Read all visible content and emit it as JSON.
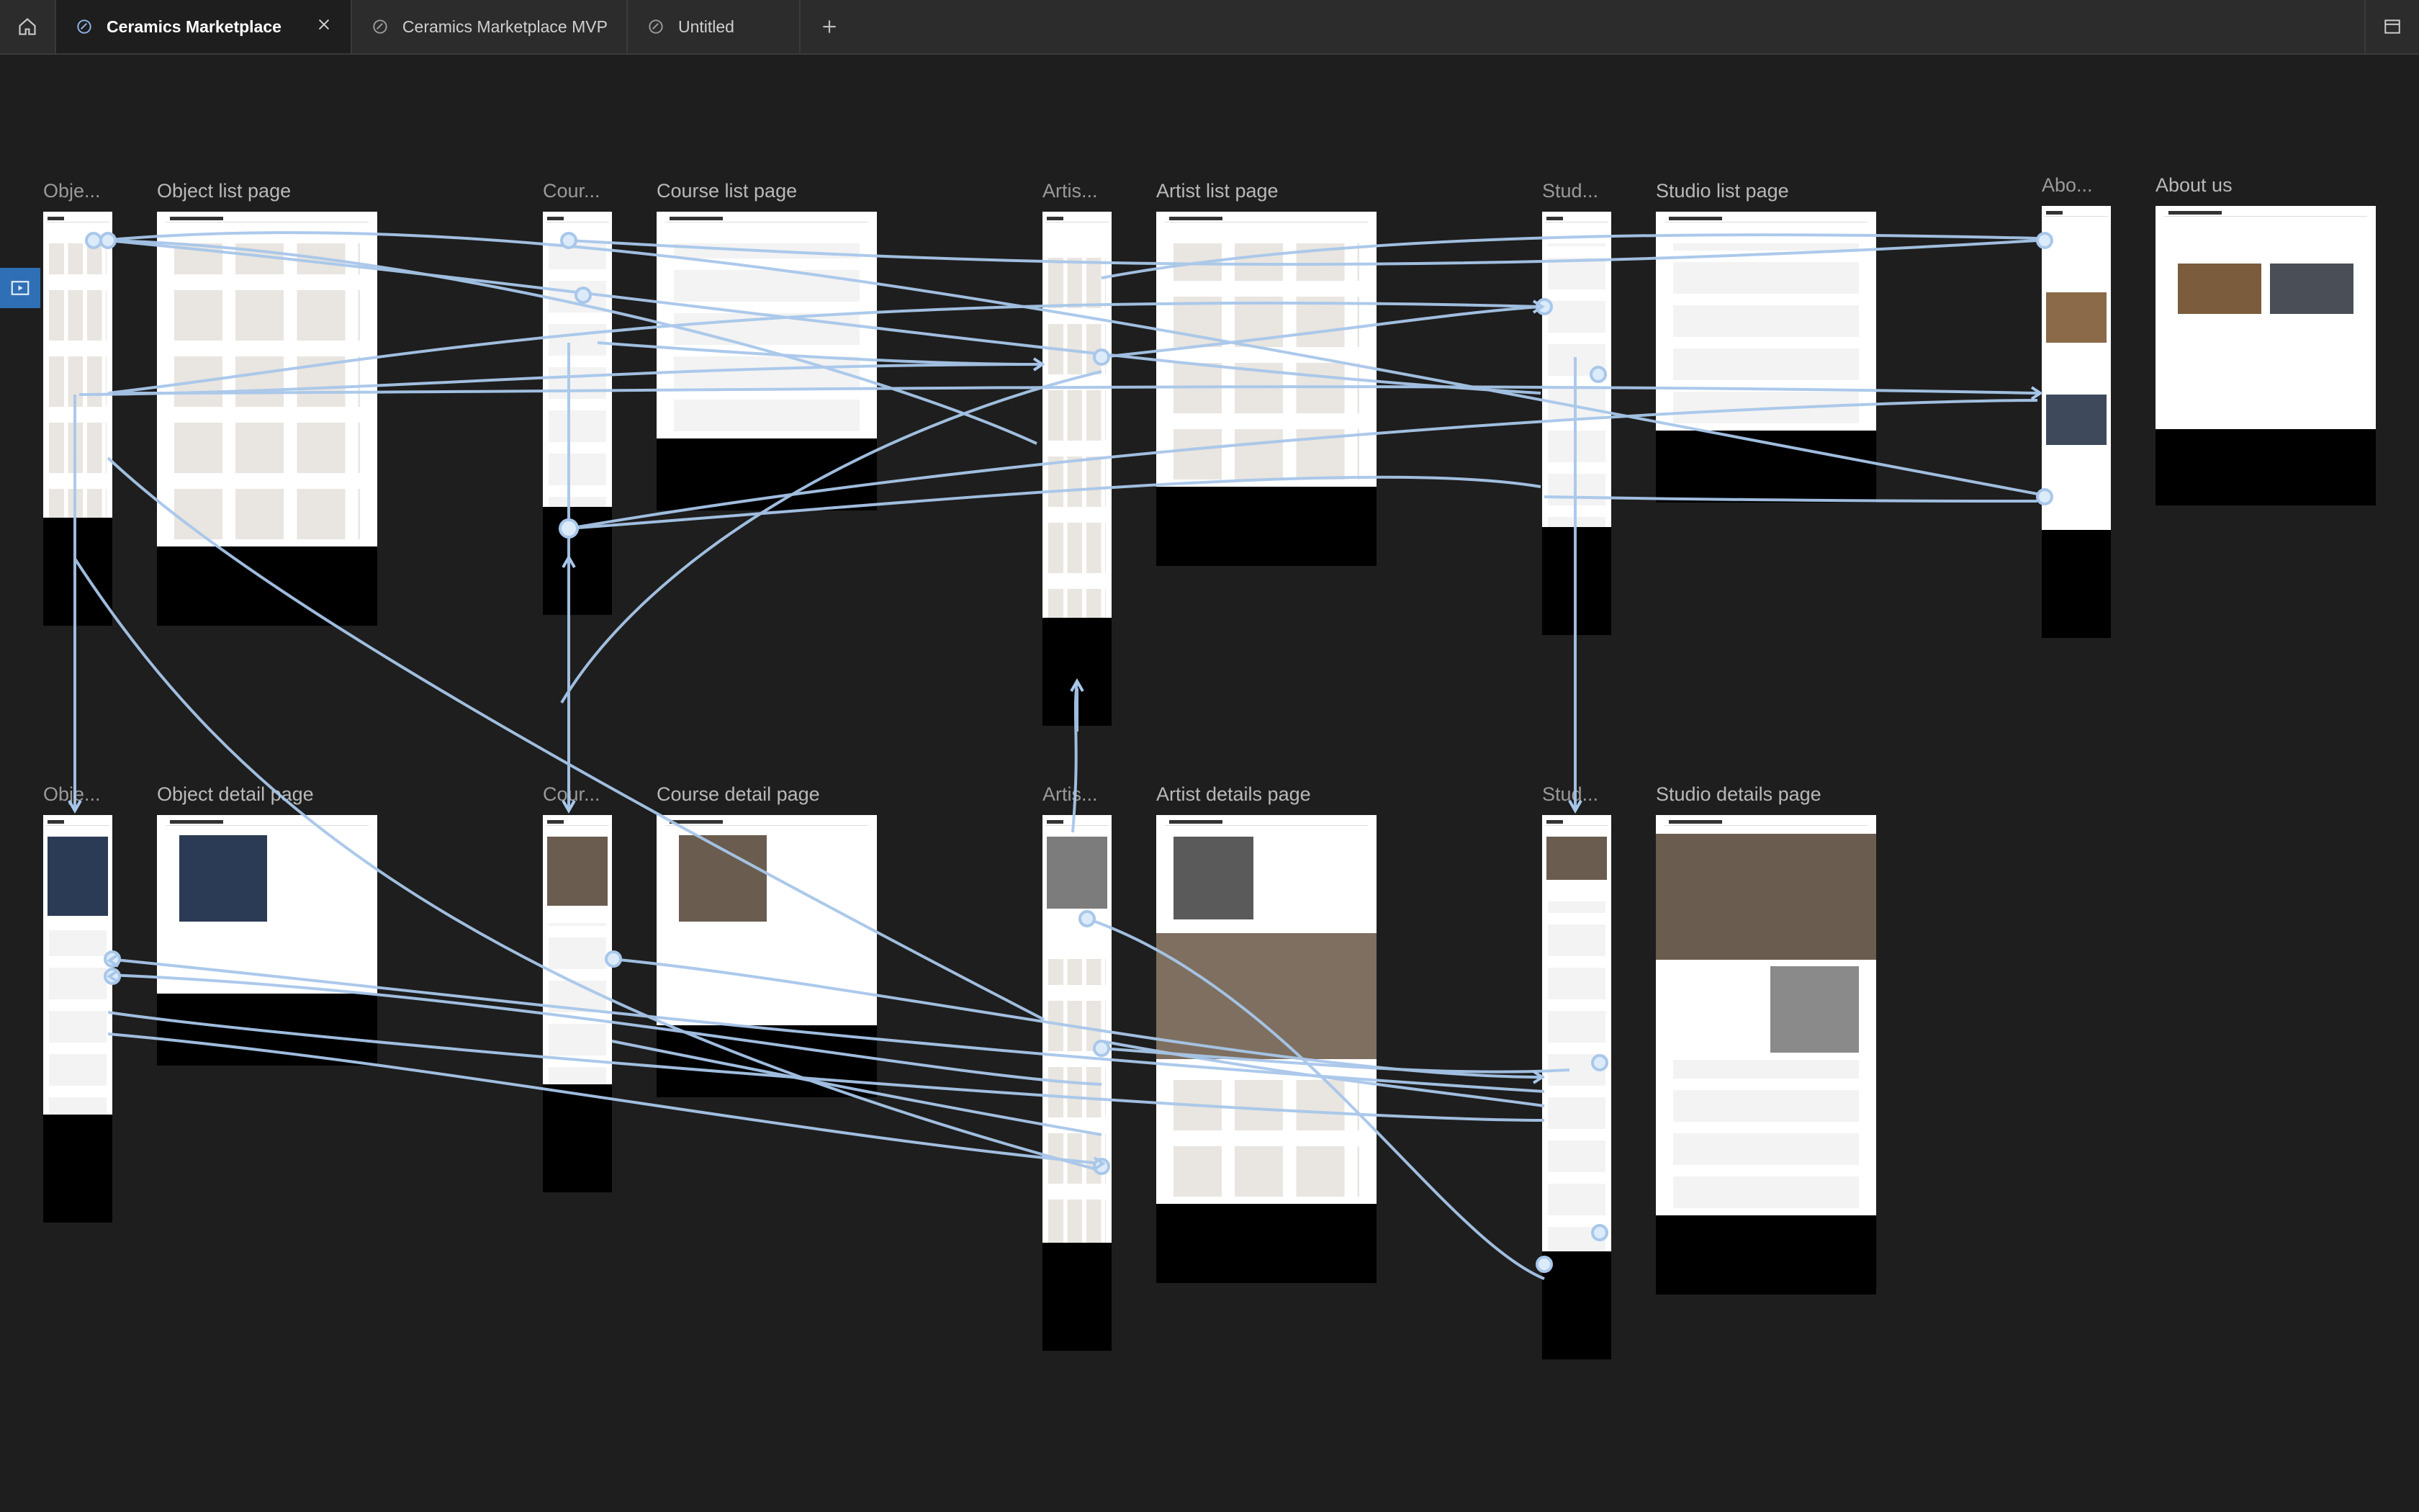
{
  "tabs": [
    {
      "label": "Ceramics Marketplace",
      "active": true
    },
    {
      "label": "Ceramics Marketplace MVP",
      "active": false
    },
    {
      "label": "Untitled",
      "active": false
    }
  ],
  "icons": {
    "home": "home-icon",
    "file": "file-icon",
    "close": "close-icon",
    "add": "plus-icon",
    "panel": "panel-icon",
    "flow": "flow-start-icon"
  },
  "colors": {
    "canvas": "#1e1e1e",
    "tabbar": "#2c2c2c",
    "connector": "#a8c7ea",
    "frame_label": "#9a9a9a"
  },
  "frames": {
    "object_list_mobile": "Obje...",
    "object_list": "Object list page",
    "course_list_mobile": "Cour...",
    "course_list": "Course list page",
    "artist_list_mobile": "Artis...",
    "artist_list": "Artist list page",
    "studio_list_mobile": "Stud...",
    "studio_list": "Studio list page",
    "about_mobile": "Abo...",
    "about": "About us",
    "object_detail_mobile": "Obje...",
    "object_detail": "Object detail page",
    "course_detail_mobile": "Cour...",
    "course_detail": "Course detail page",
    "artist_detail_mobile": "Artis...",
    "artist_detail": "Artist details page",
    "studio_detail_mobile": "Stud...",
    "studio_detail": "Studio details page"
  }
}
